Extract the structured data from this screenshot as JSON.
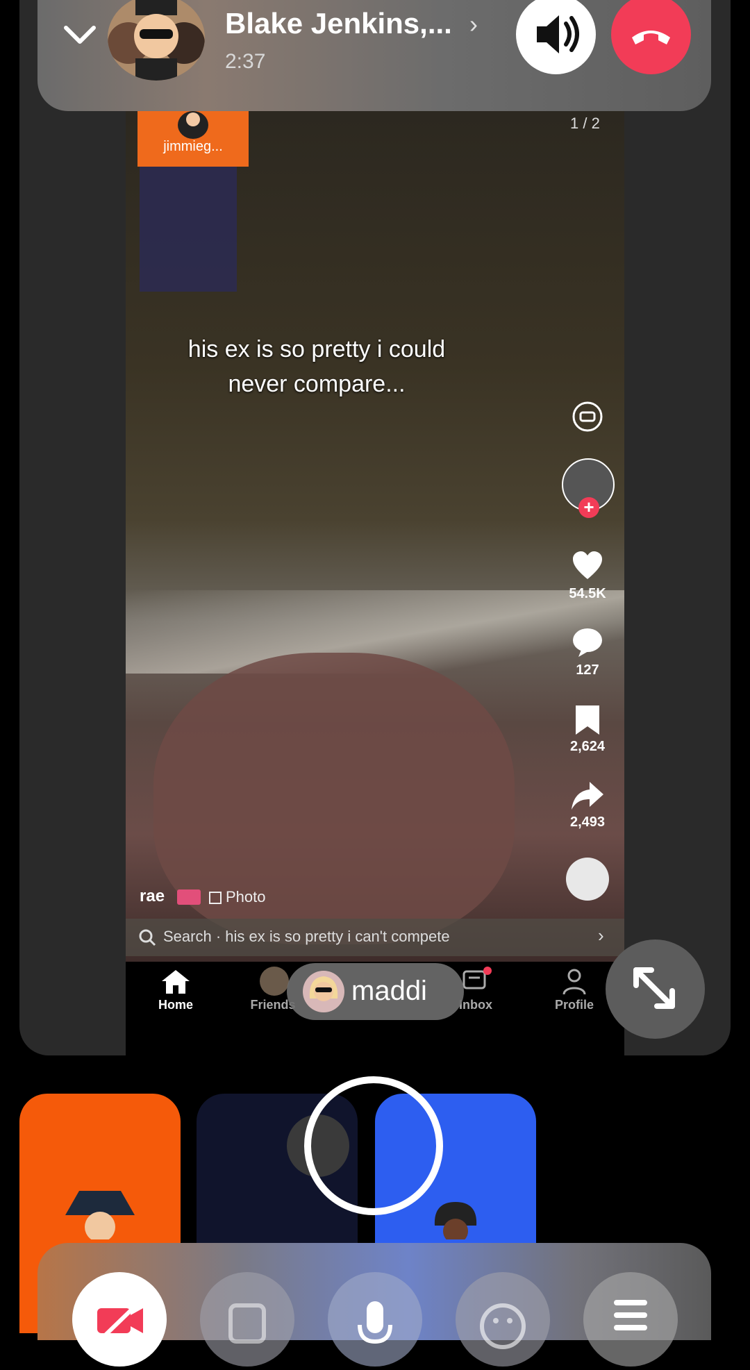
{
  "call": {
    "caller_name": "Blake Jenkins,...",
    "duration": "2:37",
    "icons": {
      "collapse": "chevron-down-icon",
      "details": "chevron-right-icon",
      "speaker": "speaker-icon",
      "end": "end-call-icon"
    }
  },
  "shared_video": {
    "thumbnail_user": "jimmieg...",
    "page_indicator": "1 / 2",
    "caption_line1": "his ex is so pretty i could",
    "caption_line2": "never compare...",
    "likes": "54.5K",
    "comments": "127",
    "saves": "2,624",
    "shares": "2,493",
    "author": "rae",
    "photo_label": "Photo",
    "search_text": "Search · his ex is so pretty i can't compete",
    "tabs": [
      {
        "label": "Home"
      },
      {
        "label": "Friends"
      },
      {
        "label": "Inbox"
      },
      {
        "label": "Profile"
      }
    ]
  },
  "participant": {
    "name": "maddi"
  },
  "controls": {
    "icons": [
      "camera-off-icon",
      "flip-camera-icon",
      "microphone-icon",
      "emoji-icon",
      "menu-icon"
    ]
  },
  "colors": {
    "end_call": "#f23c57",
    "tile_orange": "#f55a0a",
    "tile_blue": "#2d5ef0"
  }
}
